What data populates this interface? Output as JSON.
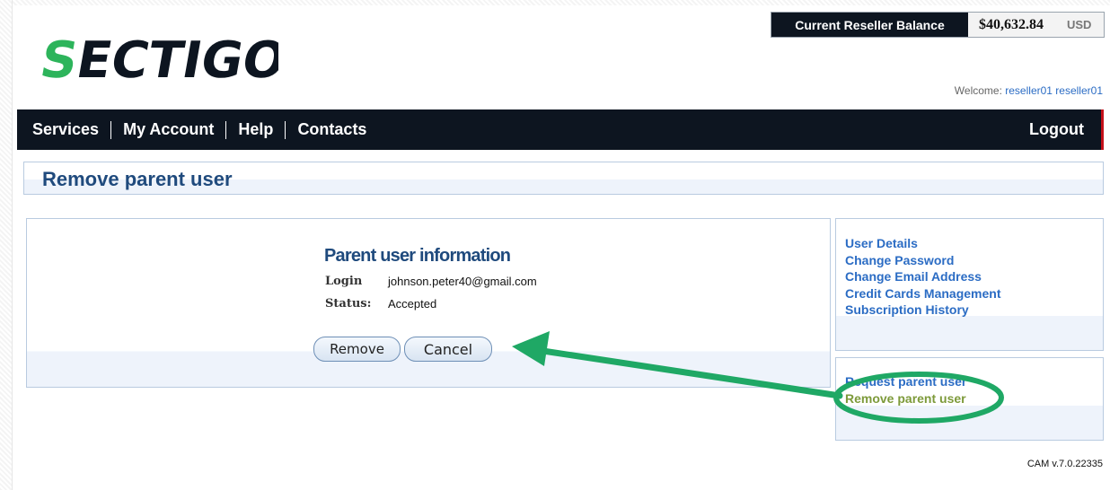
{
  "brand": {
    "logo_text": "SECTIGO",
    "accent": "#2db45b"
  },
  "balance": {
    "label": "Current Reseller Balance",
    "amount": "$40,632.84",
    "currency": "USD"
  },
  "welcome": {
    "prefix": "Welcome:",
    "user": "reseller01 reseller01"
  },
  "nav": {
    "items": [
      {
        "label": "Services"
      },
      {
        "label": "My Account"
      },
      {
        "label": "Help"
      },
      {
        "label": "Contacts"
      }
    ],
    "logout_label": "Logout"
  },
  "page": {
    "title": "Remove parent user"
  },
  "parent_info": {
    "heading": "Parent user information",
    "fields": [
      {
        "label": "Login",
        "value": "johnson.peter40@gmail.com"
      },
      {
        "label": "Status:",
        "value": "Accepted"
      }
    ]
  },
  "actions": {
    "remove_label": "Remove",
    "cancel_label": "Cancel"
  },
  "sidebar": {
    "group1": [
      {
        "label": "User Details"
      },
      {
        "label": "Change Password"
      },
      {
        "label": "Change Email Address"
      },
      {
        "label": "Credit Cards Management"
      },
      {
        "label": "Subscription History"
      }
    ],
    "group2": [
      {
        "label": "Request parent user"
      },
      {
        "label": "Remove parent user",
        "active": true
      }
    ]
  },
  "footer": {
    "version": "CAM v.7.0.22335"
  },
  "annotation": {
    "color": "#1fa865"
  }
}
